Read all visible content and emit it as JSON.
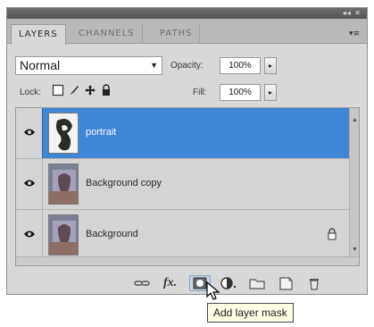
{
  "panel": {
    "tabs": [
      {
        "label": "LAYERS",
        "active": true
      },
      {
        "label": "CHANNELS",
        "active": false
      },
      {
        "label": "PATHS",
        "active": false
      }
    ],
    "titlebar_controls": "◂◂ ✕",
    "menu_glyph": "▾≡"
  },
  "options": {
    "blend_mode": "Normal",
    "opacity_label": "Opacity:",
    "opacity_value": "100%",
    "lock_label": "Lock:",
    "fill_label": "Fill:",
    "fill_value": "100%",
    "stepper_glyph": "▸"
  },
  "layers": [
    {
      "name": "portrait",
      "selected": true,
      "visible": true,
      "locked": false
    },
    {
      "name": "Background copy",
      "selected": false,
      "visible": true,
      "locked": false
    },
    {
      "name": "Background",
      "selected": false,
      "visible": true,
      "locked": true
    }
  ],
  "footer": {
    "icons": [
      "link-layers-icon",
      "layer-style-fx-icon",
      "add-layer-mask-icon",
      "adjustment-layer-icon",
      "new-group-icon",
      "new-layer-icon",
      "trash-icon"
    ],
    "fx_label": "fx."
  },
  "tooltip": {
    "text": "Add layer mask"
  },
  "colors": {
    "selection": "#3f86d4",
    "panel_bg": "#d8d8d8",
    "tab_bar": "#b9b9b9"
  }
}
